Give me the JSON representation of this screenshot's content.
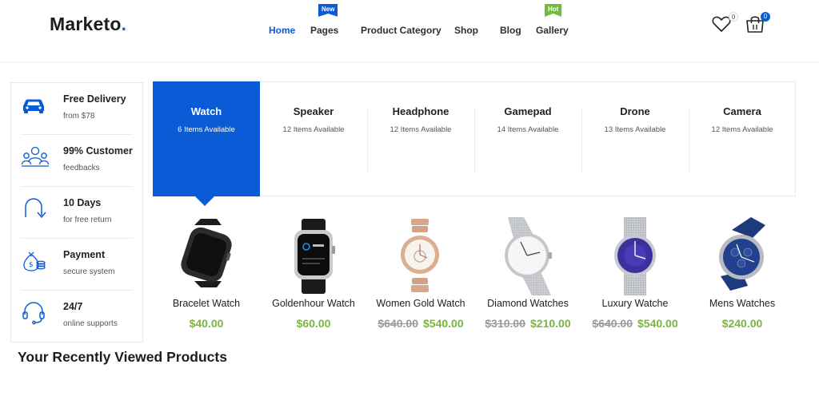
{
  "header": {
    "logo": "Marketo",
    "logo_dot": ".",
    "nav": [
      {
        "label": "Home",
        "active": true
      },
      {
        "label": "Pages",
        "badge": "New"
      },
      {
        "label": "Product Category"
      },
      {
        "label": "Shop"
      },
      {
        "label": "Blog"
      },
      {
        "label": "Gallery",
        "badge": "Hot"
      }
    ],
    "wishlist_count": "0",
    "cart_count": "0"
  },
  "features": [
    {
      "title": "Free Delivery",
      "sub": "from $78",
      "icon": "car-icon"
    },
    {
      "title": "99% Customer",
      "sub": "feedbacks",
      "icon": "customers-icon"
    },
    {
      "title": "10 Days",
      "sub": "for free return",
      "icon": "return-arrow-icon"
    },
    {
      "title": "Payment",
      "sub": "secure system",
      "icon": "money-bag-icon"
    },
    {
      "title": "24/7",
      "sub": "online supports",
      "icon": "headset-icon"
    }
  ],
  "categories": [
    {
      "name": "Watch",
      "count": "6 Items Available",
      "active": true
    },
    {
      "name": "Speaker",
      "count": "12 Items Available"
    },
    {
      "name": "Headphone",
      "count": "12 Items Available"
    },
    {
      "name": "Gamepad",
      "count": "14 Items Available"
    },
    {
      "name": "Drone",
      "count": "13 Items Available"
    },
    {
      "name": "Camera",
      "count": "12 Items Available"
    }
  ],
  "products": [
    {
      "name": "Bracelet Watch",
      "old_price": "",
      "price": "$40.00",
      "image": "black-smartwatch-image"
    },
    {
      "name": "Goldenhour Watch",
      "old_price": "",
      "price": "$60.00",
      "image": "silver-smartwatch-image"
    },
    {
      "name": "Women Gold Watch",
      "old_price": "$640.00",
      "price": "$540.00",
      "image": "rose-gold-watch-image"
    },
    {
      "name": "Diamond Watches",
      "old_price": "$310.00",
      "price": "$210.00",
      "image": "white-dial-mesh-watch-image"
    },
    {
      "name": "Luxury Watche",
      "old_price": "$640.00",
      "price": "$540.00",
      "image": "purple-dial-mesh-watch-image"
    },
    {
      "name": "Mens Watches",
      "old_price": "",
      "price": "$240.00",
      "image": "blue-leather-watch-image"
    }
  ],
  "recent_title": "Your Recently Viewed Products",
  "colors": {
    "accent": "#0a5bd6",
    "price_green": "#7ab43e",
    "hot_badge": "#6dbd3e"
  }
}
